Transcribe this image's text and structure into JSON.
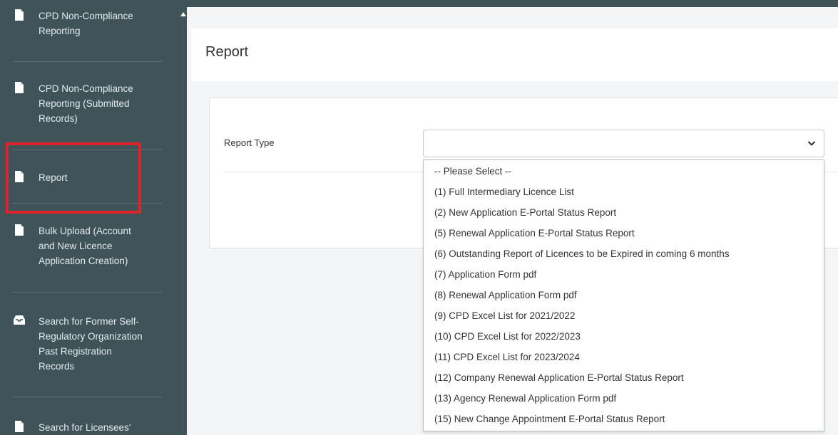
{
  "sidebar": {
    "items": [
      {
        "label": "CPD Non-Compliance\nReporting",
        "icon": "file-icon"
      },
      {
        "label": "CPD Non-Compliance\nReporting (Submitted\nRecords)",
        "icon": "file-icon"
      },
      {
        "label": "Report",
        "icon": "file-icon"
      },
      {
        "label": "Bulk Upload (Account\nand New Licence\nApplication Creation)",
        "icon": "file-icon"
      },
      {
        "label": "Search for Former Self-\nRegulatory Organization\nPast Registration\nRecords",
        "icon": "inbox-icon"
      },
      {
        "label": "Search for Licensees'",
        "icon": "file-icon"
      }
    ]
  },
  "page": {
    "title": "Report"
  },
  "form": {
    "report_type_label": "Report Type",
    "selected_value": ""
  },
  "dropdown": {
    "options": [
      "-- Please Select --",
      "(1) Full Intermediary Licence List",
      "(2) New Application E-Portal Status Report",
      "(5) Renewal Application E-Portal Status Report",
      "(6) Outstanding Report of Licences to be Expired in coming 6 months",
      "(7) Application Form pdf",
      "(8) Renewal Application Form pdf",
      "(9) CPD Excel List for 2021/2022",
      "(10) CPD Excel List for 2022/2023",
      "(11) CPD Excel List for 2023/2024",
      "(12) Company Renewal Application E-Portal Status Report",
      "(13) Agency Renewal Application Form pdf",
      "(15) New Change Appointment E-Portal Status Report"
    ]
  },
  "colors": {
    "sidebar_bg": "#3f5358",
    "highlight_border": "#e0222a"
  }
}
